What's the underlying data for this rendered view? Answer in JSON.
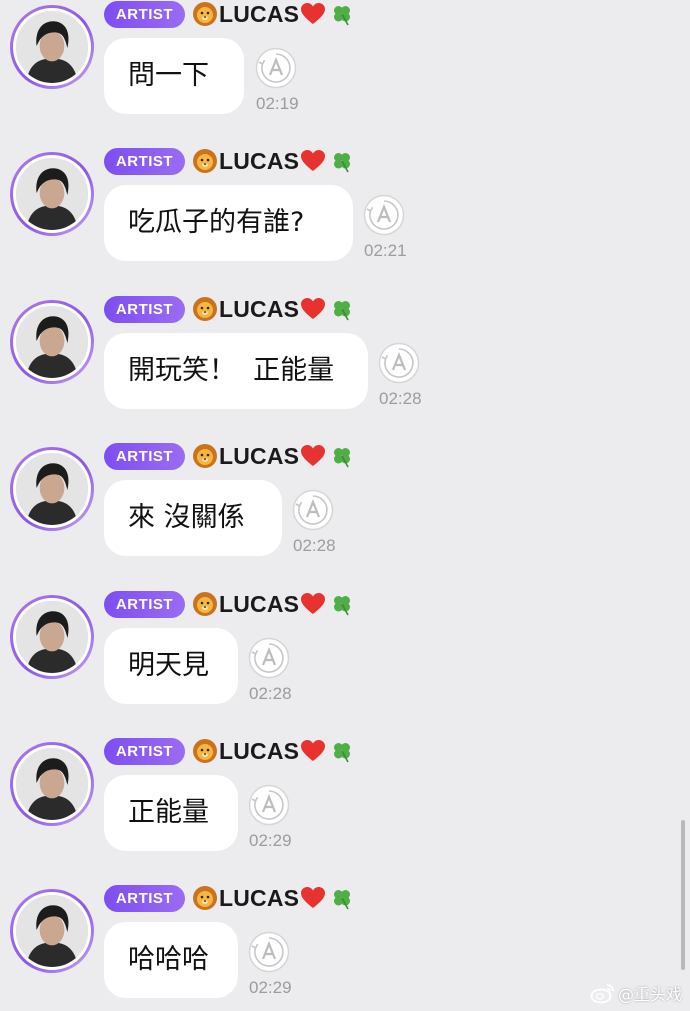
{
  "messages": [
    {
      "badge": "ARTIST",
      "name": "LUCAS",
      "text": "問一下",
      "time": "02:19"
    },
    {
      "badge": "ARTIST",
      "name": "LUCAS",
      "text": "吃瓜子的有誰?",
      "time": "02:21"
    },
    {
      "badge": "ARTIST",
      "name": "LUCAS",
      "text": "開玩笑！  正能量",
      "time": "02:28"
    },
    {
      "badge": "ARTIST",
      "name": "LUCAS",
      "text": "來 沒關係",
      "time": "02:28"
    },
    {
      "badge": "ARTIST",
      "name": "LUCAS",
      "text": "明天見",
      "time": "02:28"
    },
    {
      "badge": "ARTIST",
      "name": "LUCAS",
      "text": "正能量",
      "time": "02:29"
    },
    {
      "badge": "ARTIST",
      "name": "LUCAS",
      "text": "哈哈哈",
      "time": "02:29"
    }
  ],
  "icons": {
    "name_prefix": "lion-face-icon",
    "name_suffix": [
      "red-heart-icon",
      "four-leaf-clover-icon"
    ],
    "reply": "auto-translate-icon",
    "watermark": "weibo-logo-icon"
  },
  "colors": {
    "artist_badge": "#8257f0",
    "avatar_ring": "#a06cf0",
    "bubble": "#ffffff",
    "background": "#ececee",
    "time_text": "#9c9c9c"
  },
  "watermark": {
    "text": "@重头戏"
  }
}
